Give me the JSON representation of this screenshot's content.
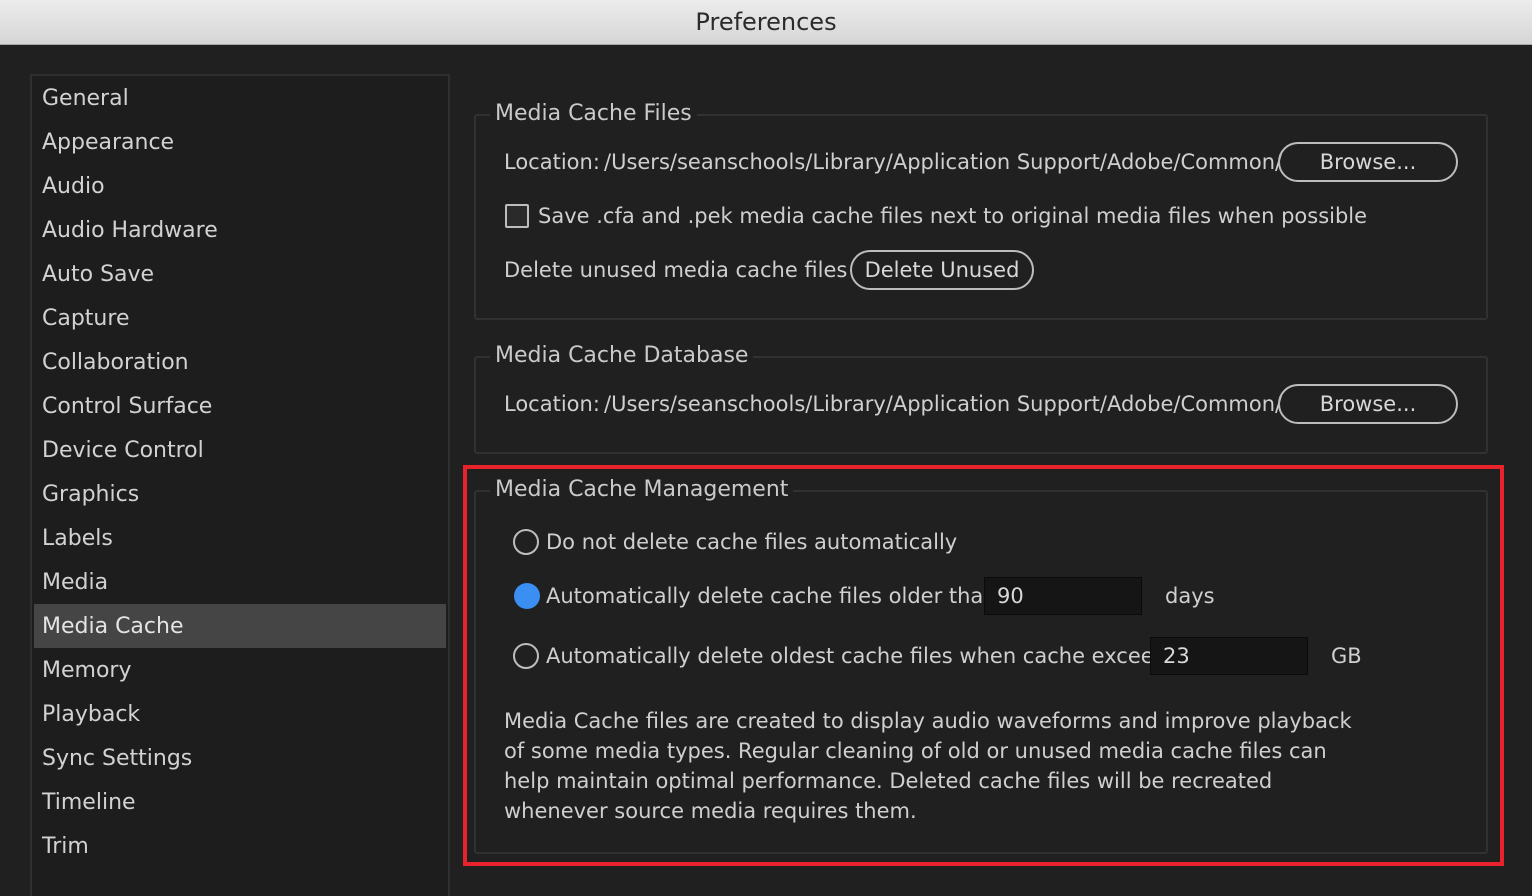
{
  "window": {
    "title": "Preferences"
  },
  "sidebar": {
    "selected": "Media Cache",
    "items": [
      "General",
      "Appearance",
      "Audio",
      "Audio Hardware",
      "Auto Save",
      "Capture",
      "Collaboration",
      "Control Surface",
      "Device Control",
      "Graphics",
      "Labels",
      "Media",
      "Media Cache",
      "Memory",
      "Playback",
      "Sync Settings",
      "Timeline",
      "Trim"
    ]
  },
  "media_cache_files": {
    "legend": "Media Cache Files",
    "location_label": "Location:",
    "location_path": "/Users/seanschools/Library/Application Support/Adobe/Common/",
    "browse_label": "Browse...",
    "save_checkbox_label": "Save .cfa and .pek media cache files next to original media files when possible",
    "save_checked": false,
    "delete_label": "Delete unused media cache files",
    "delete_button": "Delete Unused"
  },
  "media_cache_database": {
    "legend": "Media Cache Database",
    "location_label": "Location:",
    "location_path": "/Users/seanschools/Library/Application Support/Adobe/Common/",
    "browse_label": "Browse..."
  },
  "media_cache_management": {
    "legend": "Media Cache Management",
    "option_none": "Do not delete cache files automatically",
    "option_age": "Automatically delete cache files older than:",
    "age_value": "90",
    "age_unit": "days",
    "option_size": "Automatically delete oldest cache files when cache exceeds:",
    "size_value": "23",
    "size_unit": "GB",
    "selected_option": "age",
    "description": "Media Cache files are created to display audio waveforms and improve playback of some media types.  Regular cleaning of old or unused media cache files can help maintain optimal performance. Deleted cache files will be recreated whenever source media requires them."
  },
  "colors": {
    "highlight": "#e8232b",
    "radio_selected": "#3b8ef2",
    "sidebar_selected": "#454545"
  }
}
